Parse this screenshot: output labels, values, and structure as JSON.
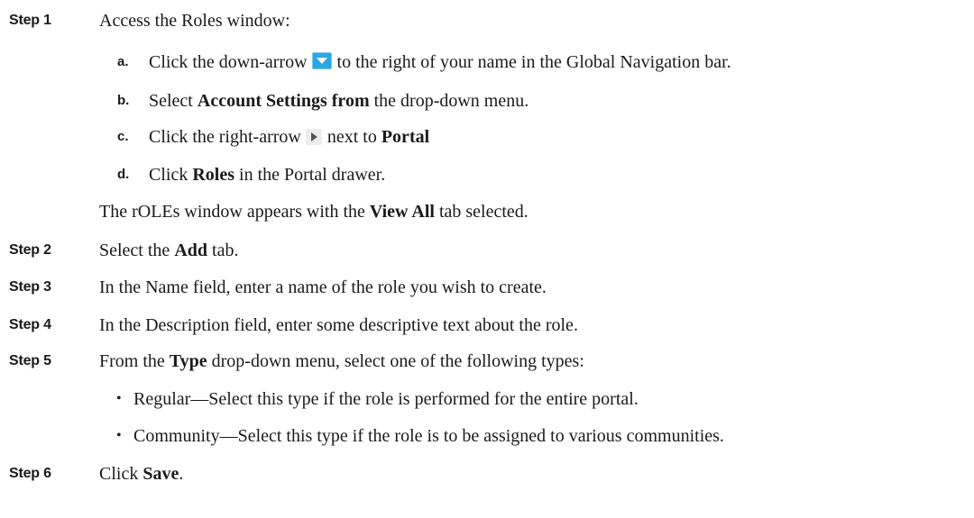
{
  "steps": [
    {
      "label": "Step 1",
      "text": "Access the Roles window:",
      "substeps": [
        {
          "letter": "a.",
          "pre": "Click the down-arrow",
          "icon": "down-arrow-icon",
          "post": "to the right of your name in the Global Navigation bar."
        },
        {
          "letter": "b.",
          "pre": "Select",
          "bold": "Account Settings from",
          "post": "the drop-down menu."
        },
        {
          "letter": "c.",
          "pre": "Click the right-arrow",
          "icon": "right-arrow-icon",
          "mid": "next to",
          "bold": "Portal"
        },
        {
          "letter": "d.",
          "pre": "Click",
          "bold": "Roles",
          "post": "in the Portal drawer."
        }
      ],
      "result": {
        "pre": "The rOLEs window appears with the",
        "bold": "View All",
        "post": "tab selected."
      }
    },
    {
      "label": "Step 2",
      "pre": "Select the",
      "bold": "Add",
      "post": "tab."
    },
    {
      "label": "Step 3",
      "text": "In the Name field, enter a name of the role you wish to create."
    },
    {
      "label": "Step 4",
      "text": "In the Description field, enter some descriptive text about the role."
    },
    {
      "label": "Step 5",
      "pre": "From the",
      "bold": "Type",
      "post": "drop-down menu, select one of the following types:",
      "bullets": [
        "Regular—Select this type if the role is performed for the entire portal.",
        "Community—Select this type if the role is to be assigned to various communities."
      ]
    },
    {
      "label": "Step 6",
      "pre": "Click",
      "bold": "Save",
      "post": "."
    }
  ]
}
